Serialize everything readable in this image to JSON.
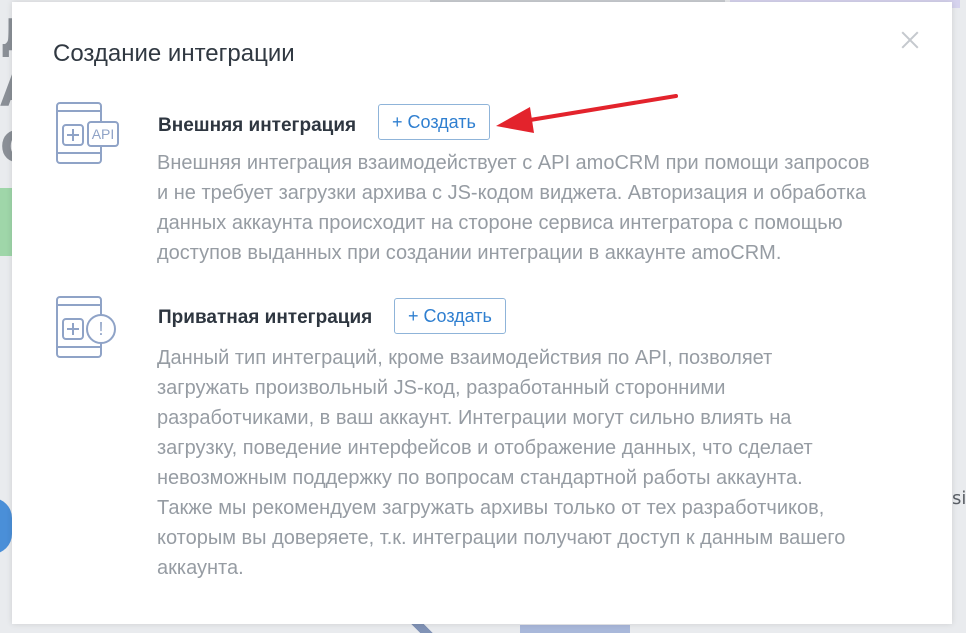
{
  "background": {
    "right_text": "si"
  },
  "modal": {
    "title": "Создание интеграции"
  },
  "sections": [
    {
      "heading": "Внешняя интеграция",
      "button_label": "+ Создать",
      "icon_badge": "API",
      "description_lines": [
        "Внешняя интеграция взаимодействует с API amoCRM при помощи запросов",
        "и не требует загрузки архива с JS-кодом виджета. Авторизация и обработка",
        "данных аккаунта происходит на стороне сервиса интегратора с помощью",
        "доступов выданных при создании интеграции в аккаунте amoCRM."
      ]
    },
    {
      "heading": "Приватная интеграция",
      "button_label": "+ Создать",
      "icon_badge": "!",
      "description_lines": [
        "Данный тип интеграций, кроме взаимодействия по API, позволяет",
        "загружать произвольный JS-код, разработанный сторонними",
        "разработчиками, в ваш аккаунт. Интеграции могут сильно влиять на",
        "загрузку, поведение интерфейсов и отображение данных, что сделает",
        "невозможным поддержку по вопросам стандартной работы аккаунта.",
        "Также мы рекомендуем загружать архивы только от тех разработчиков,",
        "которым вы доверяете, т.к. интеграции получают доступ к данным вашего",
        "аккаунта."
      ]
    }
  ],
  "colors": {
    "accent": "#2f7fd0",
    "arrow": "#e3232c",
    "icon_stroke": "#8fa3c7"
  }
}
